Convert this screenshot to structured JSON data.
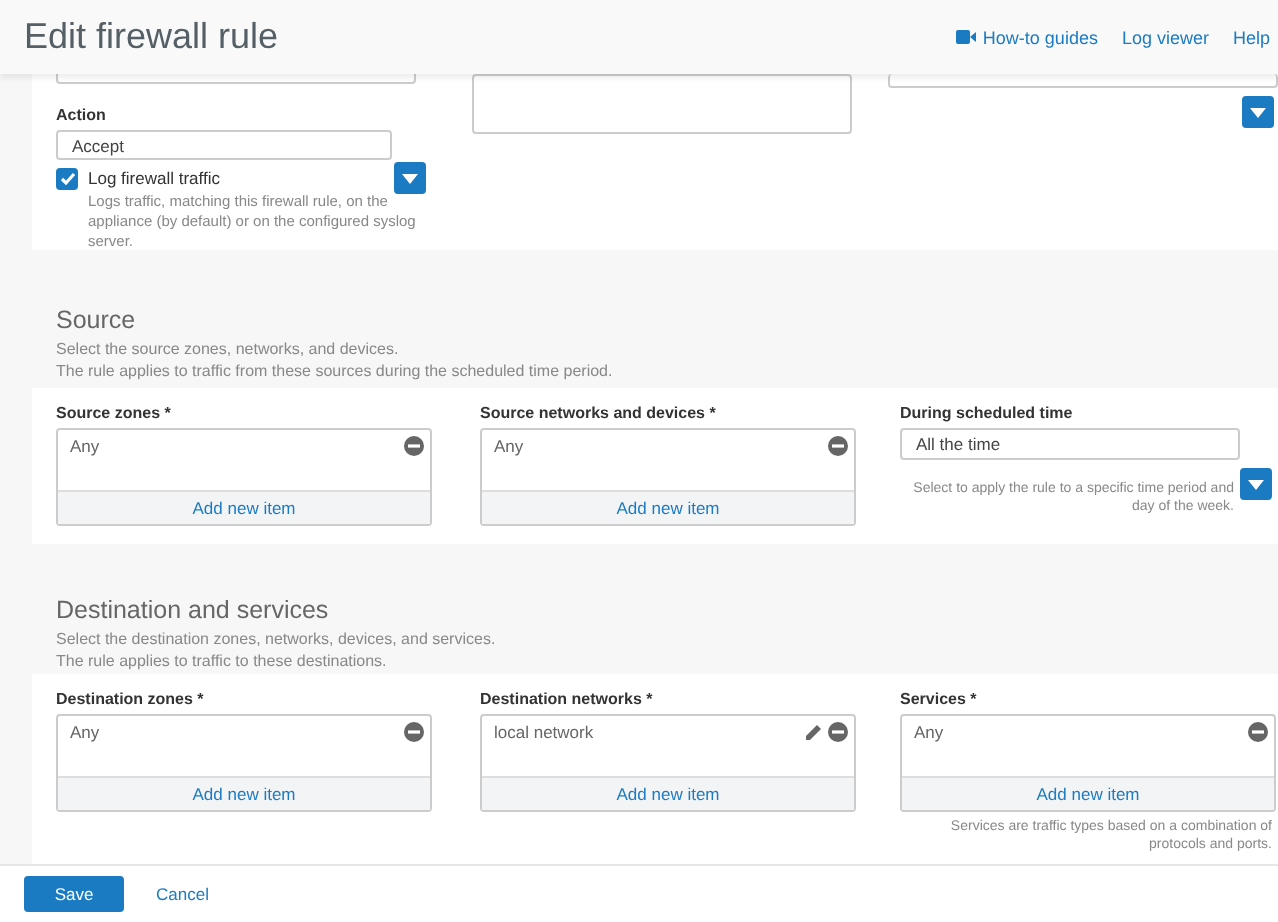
{
  "header": {
    "title": "Edit firewall rule",
    "links": [
      {
        "label": "How-to guides"
      },
      {
        "label": "Log viewer"
      },
      {
        "label": "Help"
      }
    ]
  },
  "top": {
    "action": {
      "label": "Action",
      "value": "Accept"
    },
    "log": {
      "label": "Log firewall traffic",
      "checked": true,
      "hint": "Logs traffic, matching this firewall rule, on the appliance (by default) or on the configured syslog server."
    }
  },
  "sections": [
    {
      "title": "Source",
      "description": [
        "Select the source zones, networks, and devices.",
        "The rule applies to traffic from these sources during the scheduled time period."
      ],
      "fields": [
        {
          "kind": "list",
          "label": "Source zones *",
          "items": [
            {
              "text": "Any",
              "editable": false
            }
          ],
          "add": "Add new item"
        },
        {
          "kind": "list",
          "label": "Source networks and devices *",
          "items": [
            {
              "text": "Any",
              "editable": false
            }
          ],
          "add": "Add new item"
        },
        {
          "kind": "select",
          "label": "During scheduled time",
          "value": "All the time",
          "hint": "Select to apply the rule to a specific time period and day of the week."
        }
      ]
    },
    {
      "title": "Destination and services",
      "description": [
        "Select the destination zones, networks, devices, and services.",
        "The rule applies to traffic to these destinations."
      ],
      "fields": [
        {
          "kind": "list",
          "label": "Destination zones *",
          "items": [
            {
              "text": "Any",
              "editable": false
            }
          ],
          "add": "Add new item"
        },
        {
          "kind": "list",
          "label": "Destination networks *",
          "items": [
            {
              "text": "local network",
              "editable": true
            }
          ],
          "add": "Add new item"
        },
        {
          "kind": "list",
          "label": "Services *",
          "items": [
            {
              "text": "Any",
              "editable": false
            }
          ],
          "add": "Add new item",
          "hint": "Services are traffic types based on a combination of protocols and ports."
        }
      ]
    }
  ],
  "footer": {
    "buttons": [
      {
        "label": "Save",
        "kind": "primary"
      },
      {
        "label": "Cancel",
        "kind": "link"
      }
    ]
  }
}
